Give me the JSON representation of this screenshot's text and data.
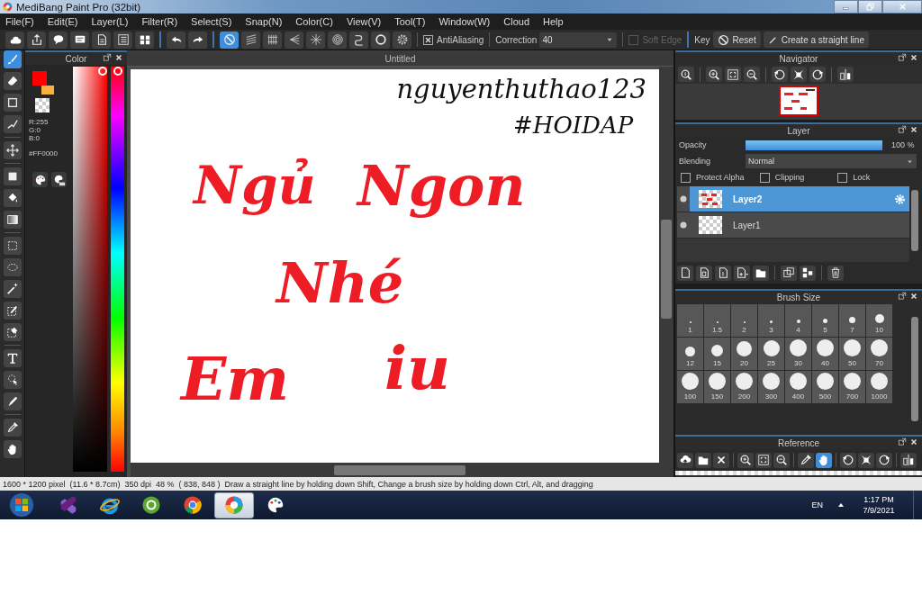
{
  "window": {
    "title": "MediBang Paint Pro (32bit)"
  },
  "menu": [
    "File(F)",
    "Edit(E)",
    "Layer(L)",
    "Filter(R)",
    "Select(S)",
    "Snap(N)",
    "Color(C)",
    "View(V)",
    "Tool(T)",
    "Window(W)",
    "Cloud",
    "Help"
  ],
  "toolbar": {
    "groups": [
      {
        "buttons": [
          {
            "kind": "cloud"
          },
          {
            "kind": "upload"
          },
          {
            "kind": "speech"
          },
          {
            "kind": "comment"
          },
          {
            "kind": "document"
          },
          {
            "kind": "checklist"
          },
          {
            "kind": "panels"
          }
        ]
      },
      {
        "buttons": [
          {
            "kind": "undo"
          },
          {
            "kind": "redo"
          }
        ]
      },
      {
        "buttons": [
          {
            "kind": "prohibition",
            "selected": true
          },
          {
            "kind": "parallel",
            "selected": false
          },
          {
            "kind": "grid",
            "selected": false
          },
          {
            "kind": "perspective",
            "selected": false
          },
          {
            "kind": "radial",
            "selected": false
          },
          {
            "kind": "concentric",
            "selected": false
          },
          {
            "kind": "curve",
            "selected": false
          },
          {
            "kind": "circle",
            "selected": false
          },
          {
            "kind": "gear",
            "selected": false
          }
        ]
      }
    ],
    "antialiasing": {
      "label": "AntiAliasing",
      "checked": true
    },
    "correction": {
      "label": "Correction",
      "value": "40"
    },
    "soft_edge": {
      "label": "Soft Edge",
      "checked": false,
      "disabled": true
    },
    "key_label": "Key",
    "reset_button": "Reset",
    "straight_line_button": "Create a straight line"
  },
  "tools": {
    "groups": [
      {
        "items": [
          {
            "kind": "brush",
            "selected": true
          },
          {
            "kind": "eraser",
            "selected": false
          },
          {
            "kind": "square",
            "selected": false
          },
          {
            "kind": "polyline",
            "selected": false
          }
        ]
      },
      {
        "items": [
          {
            "kind": "move",
            "selected": false
          }
        ]
      },
      {
        "items": [
          {
            "kind": "fill",
            "selected": false
          },
          {
            "kind": "bucket",
            "selected": false
          },
          {
            "kind": "gradient",
            "selected": false
          }
        ]
      },
      {
        "items": [
          {
            "kind": "marquee",
            "selected": false
          },
          {
            "kind": "lasso",
            "selected": false
          },
          {
            "kind": "wand",
            "selected": false
          },
          {
            "kind": "select-pen",
            "selected": false
          },
          {
            "kind": "select-eraser",
            "selected": false
          }
        ]
      },
      {
        "items": [
          {
            "kind": "text",
            "selected": false
          },
          {
            "kind": "select-pointer",
            "selected": false
          },
          {
            "kind": "knife",
            "selected": false
          }
        ]
      },
      {
        "items": [
          {
            "kind": "eyedropper",
            "selected": false
          },
          {
            "kind": "hand",
            "selected": false
          }
        ]
      }
    ]
  },
  "color_panel": {
    "title": "Color",
    "swatches": [
      {
        "color": "#ff0000"
      },
      {
        "color": "#f8b040"
      }
    ],
    "rgb": [
      "R:255",
      "G:0",
      "B:0"
    ],
    "hex": "#FF0000",
    "hue_slider": {
      "level": 0
    }
  },
  "canvas": {
    "tab": "Untitled",
    "strokes": [
      {
        "text": "nguyenthuthao123",
        "color": "#111111"
      },
      {
        "text": "#HOIDAP",
        "color": "#111111"
      },
      {
        "text": "Ngủ",
        "color": "#ee1c24"
      },
      {
        "text": "Ngon",
        "color": "#ee1c24"
      },
      {
        "text": "Nhé",
        "color": "#ee1c24"
      },
      {
        "text": "Em",
        "color": "#ee1c24"
      },
      {
        "text": "iu",
        "color": "#ee1c24"
      }
    ]
  },
  "navigator": {
    "title": "Navigator"
  },
  "layer_panel": {
    "title": "Layer",
    "opacity_label": "Opacity",
    "opacity": {
      "level": 1
    },
    "opacity_reading": "100 %",
    "blending_label": "Blending",
    "blending": "Normal",
    "options": [
      {
        "label": "Protect Alpha",
        "checked": false
      },
      {
        "label": "Clipping",
        "checked": false
      },
      {
        "label": "Lock",
        "checked": false
      }
    ],
    "layers": [
      {
        "name": "Layer2",
        "selected": true
      },
      {
        "name": "Layer1",
        "selected": false
      }
    ]
  },
  "brush_size": {
    "title": "Brush Size",
    "sizes": [
      "1",
      "1.5",
      "2",
      "3",
      "4",
      "5",
      "7",
      "10",
      "12",
      "15",
      "20",
      "25",
      "30",
      "40",
      "50",
      "70",
      "100",
      "150",
      "200",
      "300",
      "400",
      "500",
      "700",
      "1000"
    ]
  },
  "reference": {
    "title": "Reference",
    "buttons": [
      {
        "kind": "upload-cloud",
        "selected": false
      },
      {
        "kind": "folder",
        "selected": false
      },
      {
        "kind": "close",
        "selected": false
      },
      {
        "kind": "zoom-in",
        "selected": false
      },
      {
        "kind": "fit",
        "selected": false
      },
      {
        "kind": "zoom-out",
        "selected": false
      },
      {
        "kind": "eyedropper",
        "selected": false
      },
      {
        "kind": "hand",
        "selected": true
      },
      {
        "kind": "rotate-left",
        "selected": false
      },
      {
        "kind": "fit-screen",
        "selected": false
      },
      {
        "kind": "rotate-right",
        "selected": false
      },
      {
        "kind": "flip",
        "selected": false
      }
    ]
  },
  "status_bar": {
    "items": [
      "1600 * 1200 pixel",
      "(11.6 * 8.7cm)",
      "350 dpi",
      "48 %",
      "( 838, 848 )",
      "Draw a straight line by holding down Shift, Change a brush size by holding down Ctrl, Alt, and dragging"
    ]
  },
  "taskbar": {
    "apps": [
      {
        "kind": "ribbon",
        "selected": false
      },
      {
        "kind": "globe",
        "selected": false
      },
      {
        "kind": "leaf",
        "selected": false
      },
      {
        "kind": "browser",
        "selected": false
      },
      {
        "kind": "color-wheel",
        "selected": true
      },
      {
        "kind": "palette",
        "selected": false
      }
    ],
    "language": "EN",
    "time": "1:17 PM",
    "date": "7/9/2021"
  }
}
